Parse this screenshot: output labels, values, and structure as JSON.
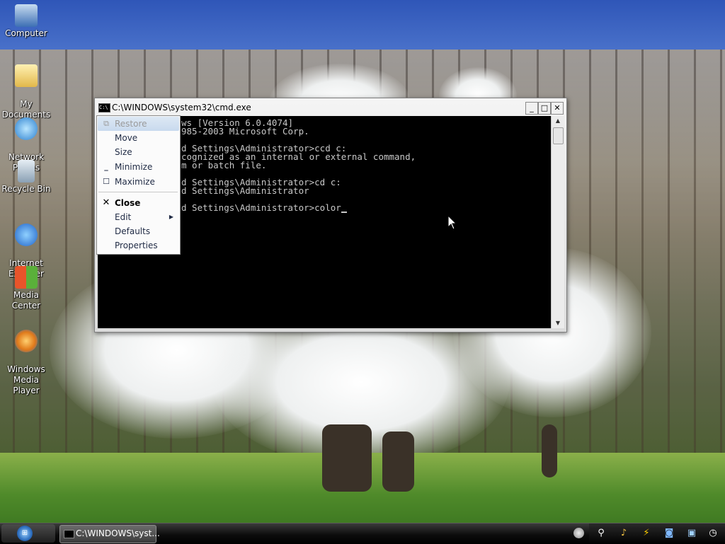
{
  "desktop": {
    "icons": [
      {
        "label": "Computer"
      },
      {
        "label": "My\nDocuments"
      },
      {
        "label": "Network\nPlaces"
      },
      {
        "label": "Recycle Bin"
      },
      {
        "label": "Internet\nExplorer"
      },
      {
        "label": "Media Center"
      },
      {
        "label": "Windows\nMedia Player"
      }
    ]
  },
  "window": {
    "title": "C:\\WINDOWS\\system32\\cmd.exe",
    "console_lines": [
      "ws [Version 6.0.4074]",
      "985-2003 Microsoft Corp.",
      "",
      "d Settings\\Administrator>ccd c:",
      "cognized as an internal or external command,",
      "m or batch file.",
      "",
      "d Settings\\Administrator>cd c:",
      "d Settings\\Administrator",
      "",
      "d Settings\\Administrator>color"
    ]
  },
  "menu": {
    "items": [
      {
        "label": "Restore"
      },
      {
        "label": "Move"
      },
      {
        "label": "Size"
      },
      {
        "label": "Minimize"
      },
      {
        "label": "Maximize"
      },
      {
        "label": "Close"
      },
      {
        "label": "Edit"
      },
      {
        "label": "Defaults"
      },
      {
        "label": "Properties"
      }
    ]
  },
  "taskbar": {
    "task_label": "C:\\WINDOWS\\syst..."
  },
  "colors": {
    "console_bg": "#000000",
    "console_fg": "#c8c8c8",
    "taskbar": "#111111"
  }
}
